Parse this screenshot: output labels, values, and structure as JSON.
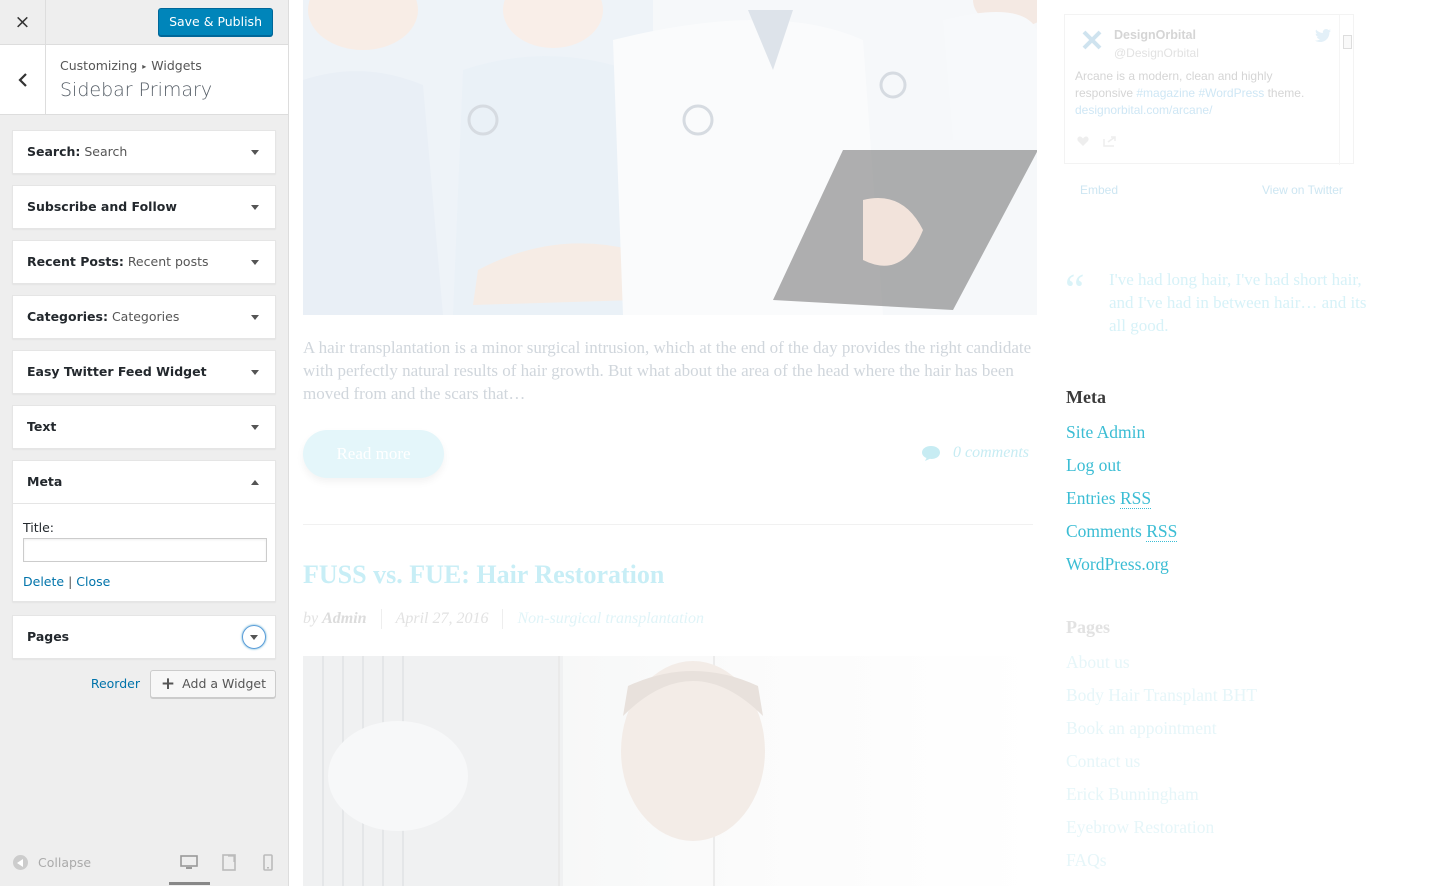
{
  "customizer": {
    "close_icon": "×",
    "publish_label": "Save & Publish",
    "breadcrumb": {
      "part1": "Customizing",
      "separator": "▸",
      "part2": "Widgets"
    },
    "section_title": "Sidebar Primary",
    "widgets": [
      {
        "name": "Search:",
        "instance": "Search"
      },
      {
        "name": "Subscribe and Follow",
        "instance": ""
      },
      {
        "name": "Recent Posts:",
        "instance": "Recent posts"
      },
      {
        "name": "Categories:",
        "instance": "Categories"
      },
      {
        "name": "Easy Twitter Feed Widget",
        "instance": ""
      },
      {
        "name": "Text",
        "instance": ""
      },
      {
        "name": "Meta",
        "instance": ""
      },
      {
        "name": "Pages",
        "instance": ""
      }
    ],
    "meta_form": {
      "title_label": "Title:",
      "title_value": "",
      "delete_label": "Delete",
      "divider": "|",
      "close_label": "Close"
    },
    "reorder_label": "Reorder",
    "add_widget_label": "Add a Widget",
    "collapse_label": "Collapse",
    "colors": {
      "primary": "#0085ba",
      "link": "#0073aa",
      "sidebar_bg": "#eeeeee"
    }
  },
  "preview": {
    "excerpt": "A hair transplantation is a minor surgical intrusion, which at the end of the day provides the right candidate with perfectly natural results of hair growth. But what about  the area of the head where the hair has been moved from and the scars that…",
    "read_more": "Read more",
    "comments": "0 comments",
    "post2": {
      "title": "FUSS vs. FUE: Hair Restoration",
      "by": "by",
      "author": "Admin",
      "date": "April 27, 2016",
      "category": "Non-surgical transplantation"
    },
    "twitter": {
      "name": "DesignOrbital",
      "handle": "@DesignOrbital",
      "text_1": "Arcane is a modern, clean and highly responsive",
      "tag1": "#magazine",
      "tag2": "#WordPress",
      "text_2": "theme.",
      "link": "designorbital.com/arcane/",
      "embed": "Embed",
      "view": "View on Twitter"
    },
    "quote": {
      "mark": "“",
      "text": "I've had long hair, I've had short hair, and I've had in between hair… and its all good."
    },
    "meta_widget": {
      "title": "Meta",
      "items": [
        "Site Admin",
        "Log out",
        "Entries",
        "Comments",
        "WordPress.org"
      ],
      "rss": "RSS"
    },
    "pages_widget": {
      "title": "Pages",
      "items": [
        "About us",
        "Body Hair Transplant BHT",
        "Book an appointment",
        "Contact us",
        "Erick Bunningham",
        "Eyebrow Restoration",
        "FAQs"
      ]
    },
    "colors": {
      "accent": "#3bbdd4"
    }
  }
}
